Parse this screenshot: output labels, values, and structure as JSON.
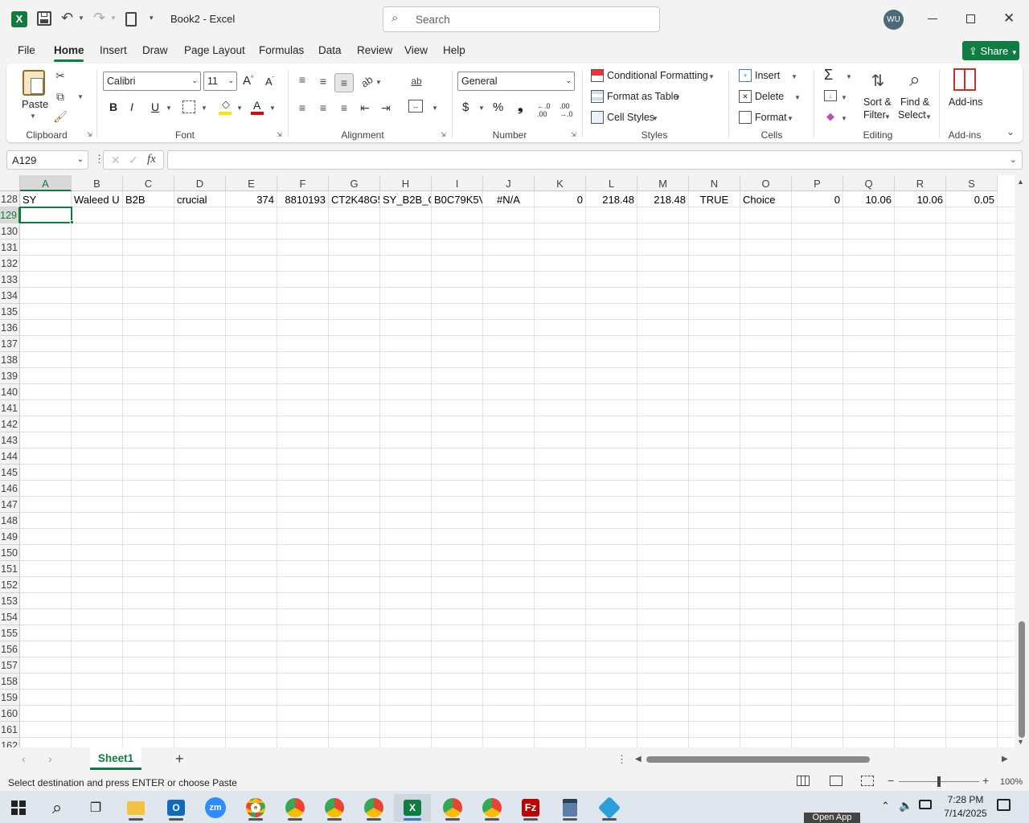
{
  "app": {
    "doc_title": "Book2",
    "separator": " - ",
    "app_name": "Excel",
    "account_initials": "WU"
  },
  "search": {
    "placeholder": "Search"
  },
  "share": {
    "label": "Share"
  },
  "tabs": [
    "File",
    "Home",
    "Insert",
    "Draw",
    "Page Layout",
    "Formulas",
    "Data",
    "Review",
    "View",
    "Help"
  ],
  "active_tab": "Home",
  "ribbon": {
    "clipboard": {
      "paste": "Paste",
      "group": "Clipboard"
    },
    "font": {
      "name": "Calibri",
      "size": "11",
      "bold": "B",
      "italic": "I",
      "underline": "U",
      "group": "Font"
    },
    "alignment": {
      "group": "Alignment"
    },
    "number": {
      "format": "General",
      "currency": "$",
      "percent": "%",
      "comma": "❟",
      "group": "Number"
    },
    "styles": {
      "conditional": "Conditional Formatting",
      "format_table": "Format as Table",
      "cell_styles": "Cell Styles",
      "group": "Styles"
    },
    "cells": {
      "insert": "Insert",
      "delete": "Delete",
      "format": "Format",
      "group": "Cells"
    },
    "editing": {
      "sort_1": "Sort &",
      "sort_2": "Filter",
      "find_1": "Find &",
      "find_2": "Select",
      "group": "Editing"
    },
    "addins": {
      "label": "Add-ins",
      "group": "Add-ins"
    }
  },
  "formula_bar": {
    "name_box": "A129",
    "fx": "fx",
    "value": ""
  },
  "columns": [
    "A",
    "B",
    "C",
    "D",
    "E",
    "F",
    "G",
    "H",
    "I",
    "J",
    "K",
    "L",
    "M",
    "N",
    "O",
    "P",
    "Q",
    "R",
    "S"
  ],
  "rows": [
    128,
    129,
    130,
    131,
    132,
    133,
    134,
    135,
    136,
    137,
    138,
    139,
    140,
    141,
    142,
    143,
    144,
    145,
    146,
    147,
    148,
    149,
    150,
    151,
    152,
    153,
    154,
    155,
    156,
    157,
    158,
    159,
    160,
    161,
    162
  ],
  "row_128": [
    "SY",
    "Waleed U",
    "B2B",
    "crucial",
    "374",
    "8810193",
    "CT2K48G5",
    "SY_B2B_C",
    "B0C79K5V",
    "#N/A",
    "0",
    "218.48",
    "218.48",
    "TRUE",
    "Choice",
    "0",
    "10.06",
    "10.06",
    "0.05"
  ],
  "active_cell": "A129",
  "sheet_tabs": [
    "Sheet1"
  ],
  "status": {
    "message": "Select destination and press ENTER or choose Paste",
    "zoom": "100%"
  },
  "taskbar": {
    "time": "7:28 PM",
    "date": "7/14/2025",
    "tooltip": "Open App"
  },
  "colors": {
    "excel_green": "#107c41",
    "accent": "#0f6cbd",
    "share_bg": "#107c41"
  }
}
